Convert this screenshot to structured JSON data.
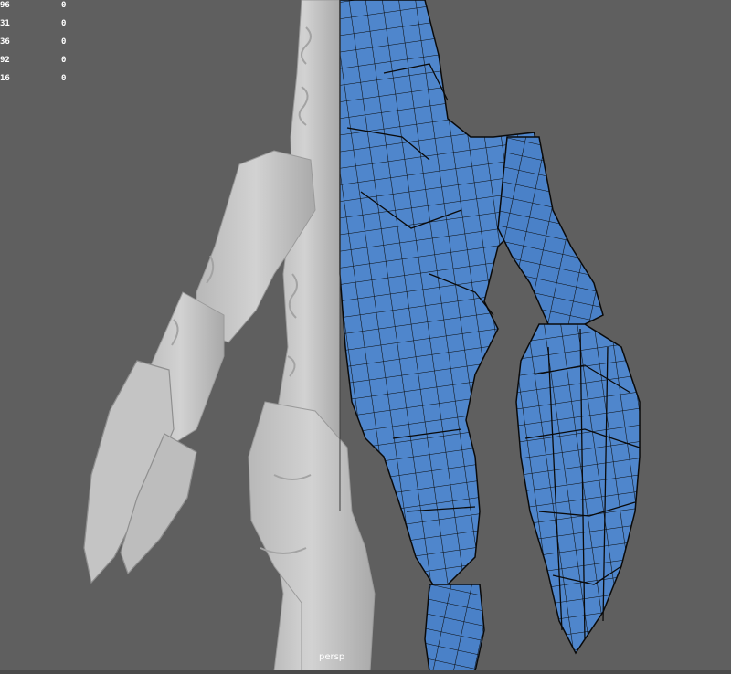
{
  "hud": {
    "rows": [
      {
        "label": "96",
        "value": "0"
      },
      {
        "label": "31",
        "value": "0"
      },
      {
        "label": "36",
        "value": "0"
      },
      {
        "label": "92",
        "value": "0"
      },
      {
        "label": "16",
        "value": "0"
      }
    ]
  },
  "viewport": {
    "camera": "persp",
    "background_color": "#5f5f5f",
    "sculpt_color": "#c9c9c9",
    "mesh_color": "#4f86cc",
    "wire_color": "#0a0a0a"
  }
}
